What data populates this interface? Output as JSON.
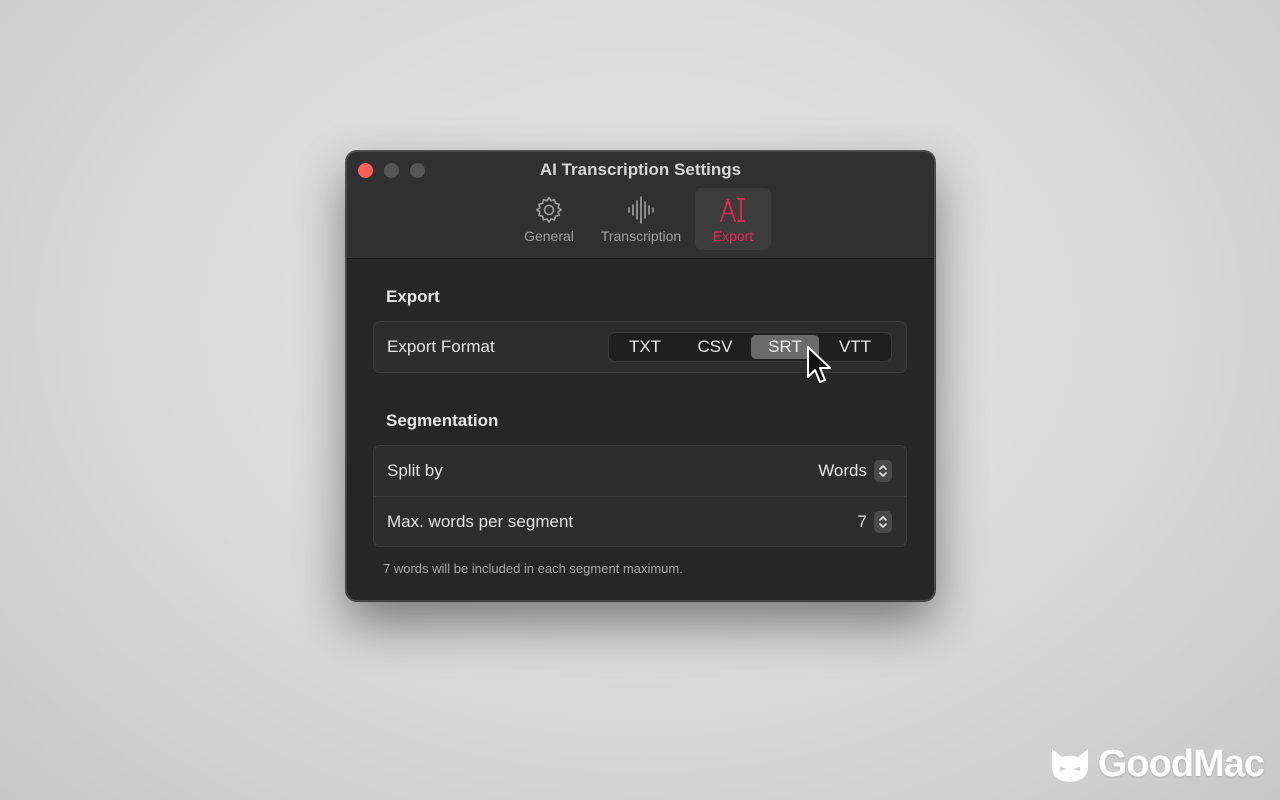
{
  "window": {
    "title": "AI Transcription Settings",
    "tabs": [
      {
        "label": "General",
        "icon": "gear-icon",
        "active": false
      },
      {
        "label": "Transcription",
        "icon": "waveform-icon",
        "active": false
      },
      {
        "label": "Export",
        "icon": "ai-text-cursor-icon",
        "active": true
      }
    ]
  },
  "export": {
    "section_title": "Export",
    "format_label": "Export Format",
    "formats": [
      "TXT",
      "CSV",
      "SRT",
      "VTT"
    ],
    "selected_format": "SRT"
  },
  "segmentation": {
    "section_title": "Segmentation",
    "split_label": "Split by",
    "split_value": "Words",
    "max_label": "Max. words per segment",
    "max_value": "7",
    "footnote": "7 words will be included in each segment maximum."
  },
  "watermark": {
    "text": "GoodMac"
  },
  "colors": {
    "accent": "#e8245e",
    "close": "#ff5f57",
    "window_bg": "#262626"
  }
}
